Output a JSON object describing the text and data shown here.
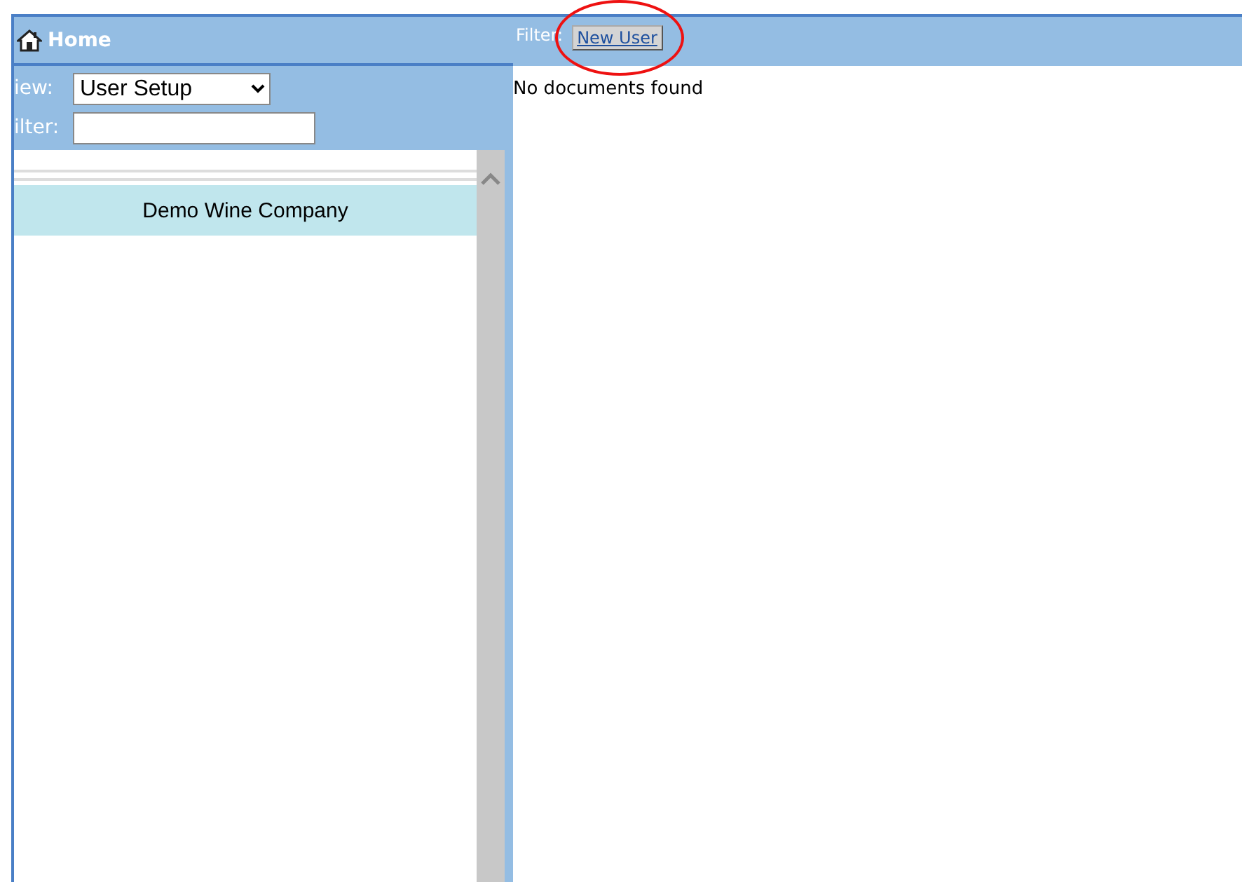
{
  "sidebar": {
    "title": "Home",
    "view": {
      "label": "iew:",
      "value": "User Setup"
    },
    "filter": {
      "label": "ilter:"
    },
    "items": [
      {
        "label": "Demo Wine Company",
        "selected": true
      }
    ]
  },
  "main": {
    "filter_label": "Filter:",
    "buttons": [
      "New User"
    ],
    "message": "No documents found",
    "highlighted": true
  }
}
